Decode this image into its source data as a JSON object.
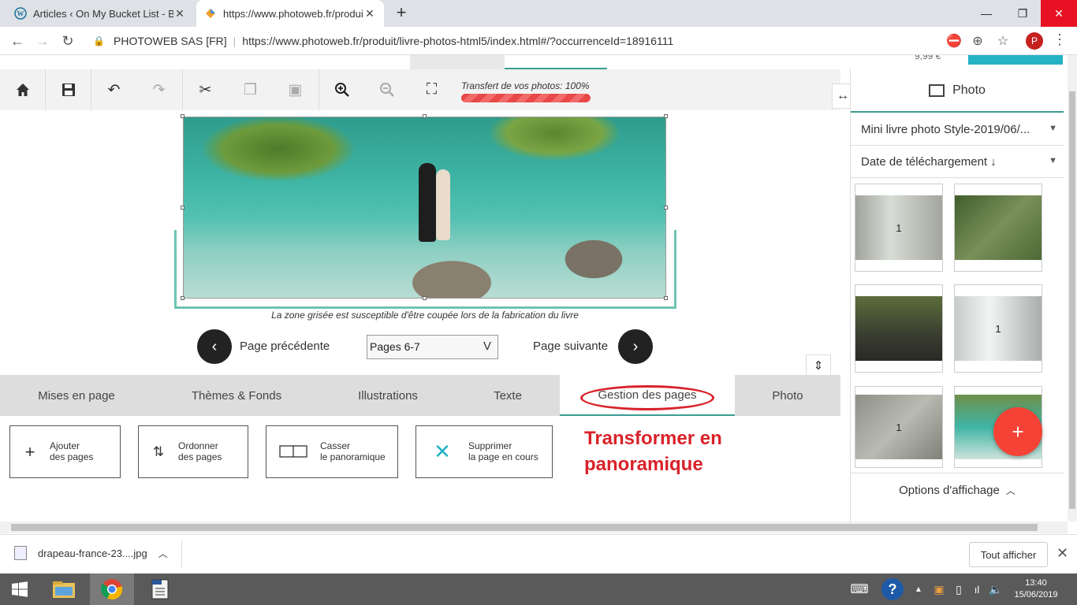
{
  "browser": {
    "tabs": [
      {
        "title": "Articles ‹ On My Bucket List - Bie"
      },
      {
        "title": "https://www.photoweb.fr/produit"
      }
    ],
    "address": {
      "site": "PHOTOWEB SAS [FR]",
      "url": "https://www.photoweb.fr/produit/livre-photos-html5/index.html#/?occurrenceId=18916111"
    },
    "avatar": "P"
  },
  "remnant": {
    "price": "9,99 €"
  },
  "editor": {
    "transfer_label": "Transfert de vos photos: 100%",
    "transfer_progress": 1.0,
    "disclaimer": "La zone grisée est susceptible d'être coupée lors de la fabrication du livre",
    "prev_label": "Page précédente",
    "next_label": "Page suivante",
    "page_select": "Pages 6-7"
  },
  "bottom_tabs": [
    {
      "label": "Mises en page"
    },
    {
      "label": "Thèmes & Fonds"
    },
    {
      "label": "Illustrations"
    },
    {
      "label": "Texte"
    },
    {
      "label": "Gestion des pages"
    },
    {
      "label": "Photo"
    }
  ],
  "actions": [
    {
      "line1": "Ajouter",
      "line2": "des pages",
      "icon": "plus-icon"
    },
    {
      "line1": "Ordonner",
      "line2": "des pages",
      "icon": "reorder-icon"
    },
    {
      "line1": "Casser",
      "line2": "le panoramique",
      "icon": "panorama-icon"
    },
    {
      "line1": "Supprimer",
      "line2": "la page en cours",
      "icon": "delete-icon"
    }
  ],
  "annotation": "Transformer en panoramique",
  "right_panel": {
    "tab_label": "Photo",
    "album": "Mini livre photo Style-2019/06/...",
    "sort": "Date de téléchargement ↓",
    "thumbs": [
      {
        "count": "1"
      },
      {
        "count": ""
      },
      {
        "count": ""
      },
      {
        "count": "1"
      },
      {
        "count": "1"
      },
      {
        "count": ""
      }
    ],
    "footer": "Options d'affichage"
  },
  "downloads": {
    "file": "drapeau-france-23....jpg",
    "show_all": "Tout afficher"
  },
  "taskbar": {
    "time": "13:40",
    "date": "15/06/2019"
  }
}
